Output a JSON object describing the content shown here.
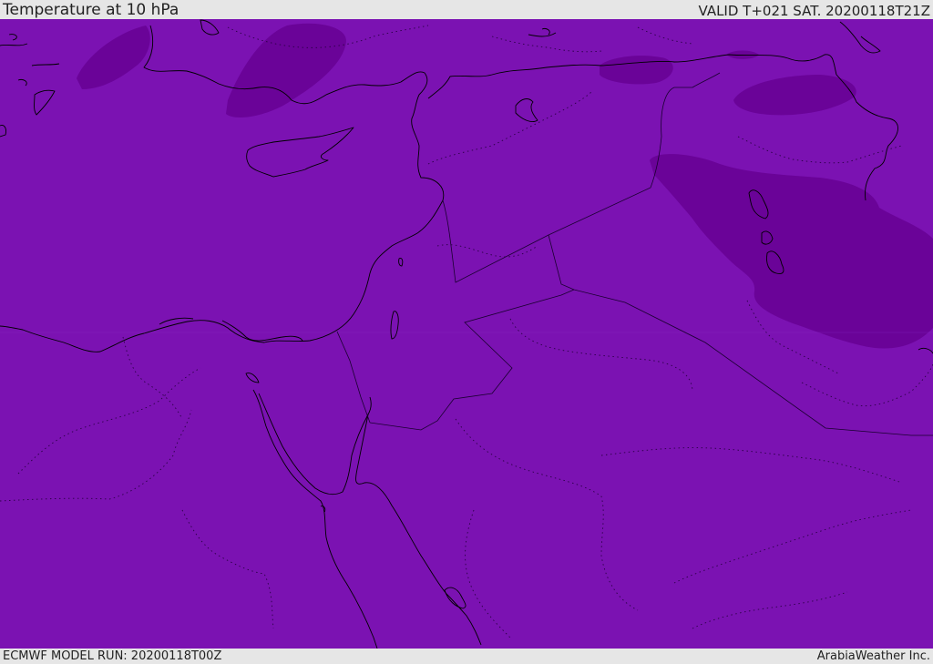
{
  "header": {
    "title": "Temperature at 10 hPa",
    "valid_time": "VALID T+021 SAT. 20200118T21Z"
  },
  "footer": {
    "model_run": "ECMWF MODEL RUN: 20200118T00Z",
    "credit": "ArabiaWeather Inc."
  },
  "colors": {
    "field_base": "#7b12b2",
    "field_cold": "#6a0398",
    "coastline": "#000000",
    "border_line": "#1a0030",
    "background": "#e6e6e6"
  }
}
